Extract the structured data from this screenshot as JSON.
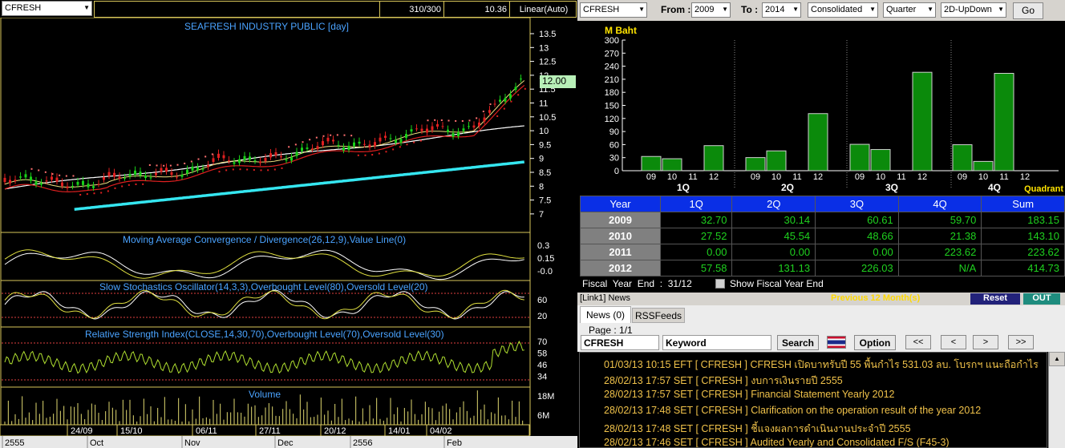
{
  "left": {
    "symbol": "CFRESH",
    "counter": "310/300",
    "last": "10.36",
    "scale": "Linear(Auto)",
    "title": "SEAFRESH INDUSTRY PUBLIC [day]",
    "price_axis": [
      "13.5",
      "13",
      "12.5",
      "12",
      "11.5",
      "11",
      "10.5",
      "10",
      "9.5",
      "9",
      "8.5",
      "8",
      "7.5",
      "7"
    ],
    "price_tag": "12.00",
    "macd_title": "Moving Average Convergence / Divergence(26,12,9),Value Line(0)",
    "macd_axis": [
      "0.3",
      "0.15",
      "-0.0"
    ],
    "stoch_title": "Slow Stochastics Oscillator(14,3,3),Overbought Level(80),Oversold Level(20)",
    "stoch_axis": [
      "60",
      "20"
    ],
    "rsi_title": "Relative Strength Index(CLOSE,14,30,70),Overbought Level(70),Oversold Level(30)",
    "rsi_axis": [
      "70",
      "58",
      "46",
      "34"
    ],
    "vol_title": "Volume",
    "vol_axis": [
      "18M",
      "6M"
    ],
    "date_ticks": [
      "24/09",
      "15/10",
      "06/11",
      "27/11",
      "20/12",
      "14/01",
      "04/02"
    ],
    "month_ticks": [
      "2555",
      "Oct",
      "Nov",
      "Dec",
      "2556",
      "Feb"
    ]
  },
  "toolbar": {
    "symbol": "CFRESH",
    "from_label": "From :",
    "from": "2009",
    "to_label": "To :",
    "to": "2014",
    "mode": "Consolidated",
    "period": "Quarter",
    "chart_type": "2D-UpDown",
    "go": "Go"
  },
  "chart_data": {
    "type": "bar",
    "ylabel": "M Baht",
    "yticks": [
      "300",
      "270",
      "240",
      "210",
      "180",
      "150",
      "120",
      "90",
      "60",
      "30",
      "0"
    ],
    "ylim": [
      0,
      300
    ],
    "groups": [
      "1Q",
      "2Q",
      "3Q",
      "4Q"
    ],
    "years": [
      "09",
      "10",
      "11",
      "12"
    ],
    "quadrant_label": "Quadrant",
    "values": [
      [
        32.7,
        27.52,
        0.0,
        57.58
      ],
      [
        30.14,
        45.54,
        0.0,
        131.13
      ],
      [
        60.61,
        48.66,
        0.0,
        226.03
      ],
      [
        59.7,
        21.38,
        223.62,
        null
      ]
    ],
    "color": "#0b8a0b"
  },
  "table": {
    "headers": [
      "Year",
      "1Q",
      "2Q",
      "3Q",
      "4Q",
      "Sum"
    ],
    "rows": [
      [
        "2009",
        "32.70",
        "30.14",
        "60.61",
        "59.70",
        "183.15"
      ],
      [
        "2010",
        "27.52",
        "45.54",
        "48.66",
        "21.38",
        "143.10"
      ],
      [
        "2011",
        "0.00",
        "0.00",
        "0.00",
        "223.62",
        "223.62"
      ],
      [
        "2012",
        "57.58",
        "131.13",
        "226.03",
        "N/A",
        "414.73"
      ]
    ]
  },
  "fiscal": {
    "label": "Fiscal  Year  End  :  31/12",
    "checkbox": "Show Fiscal Year End"
  },
  "newsbar": {
    "title": "[Link1] News",
    "prev": "Previous 12 Month(s)",
    "reset": "Reset",
    "out": "OUT"
  },
  "news": {
    "tabs": [
      "News (0)",
      "RSSFeeds"
    ],
    "page": "Page : 1/1",
    "symbol": "CFRESH",
    "keyword": "Keyword",
    "search": "Search",
    "option": "Option",
    "nav": [
      "<<",
      "<",
      ">",
      ">>"
    ],
    "items": [
      "01/03/13 10:15  EFT  [ CFRESH ]  CFRESH เปิดบาทรับปี 55 พื้นกำไร 531.03 ลบ. โบรกฯ แนะถือกำไร",
      "28/02/13 17:57  SET  [ CFRESH ]  งบการเงินรายปี 2555",
      "28/02/13 17:57  SET  [ CFRESH ]  Financial Statement Yearly 2012",
      "28/02/13 17:48  SET  [ CFRESH ]  Clarification on the operation result of the year 2012",
      "28/02/13 17:48  SET  [ CFRESH ]  ชี้แจงผลการดำเนินงานประจำปี 2555",
      "28/02/13 17:46  SET  [ CFRESH ]  Audited Yearly and Consolidated F/S (F45-3)"
    ]
  }
}
